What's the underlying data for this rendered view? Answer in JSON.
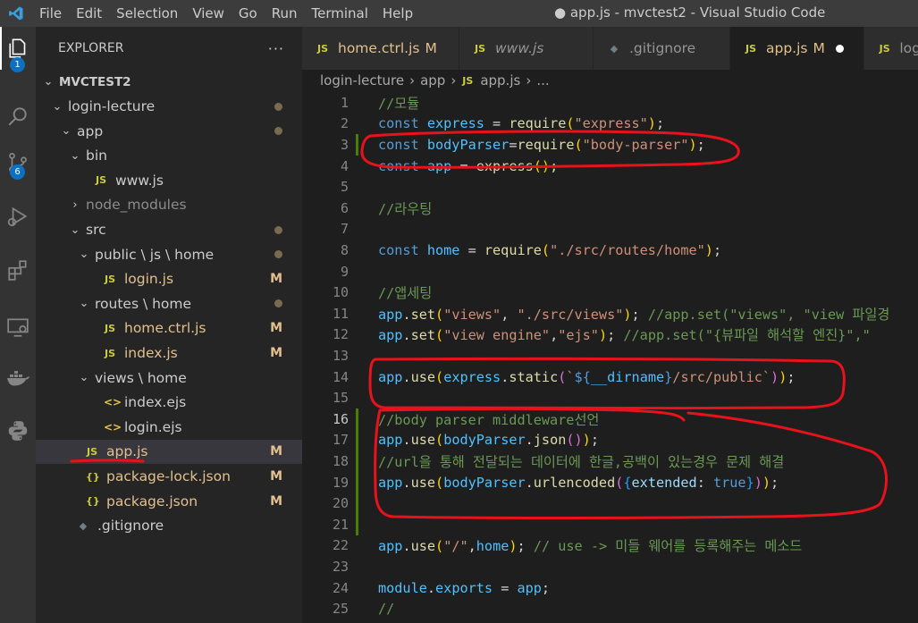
{
  "titlebar": {
    "menu": [
      "File",
      "Edit",
      "Selection",
      "View",
      "Go",
      "Run",
      "Terminal",
      "Help"
    ],
    "title": "● app.js - mvctest2 - Visual Studio Code"
  },
  "activity": {
    "icons": [
      "explorer-icon",
      "search-icon",
      "source-control-icon",
      "run-debug-icon",
      "extensions-icon",
      "remote-explorer-icon",
      "docker-icon",
      "python-icon"
    ],
    "badges": {
      "explorer": "1",
      "source_control": "6"
    }
  },
  "explorer": {
    "title": "EXPLORER",
    "more": "···",
    "project": "MVCTEST2",
    "tree": [
      {
        "label": "login-lecture",
        "status": "dot",
        "indent": 1,
        "kind": "folder-open"
      },
      {
        "label": "app",
        "status": "dot",
        "indent": 2,
        "kind": "folder-open"
      },
      {
        "label": "bin",
        "status": "",
        "indent": 3,
        "kind": "folder-open"
      },
      {
        "label": "www.js",
        "status": "",
        "indent": 4,
        "kind": "js"
      },
      {
        "label": "node_modules",
        "status": "",
        "indent": 3,
        "kind": "folder-closed",
        "muted": true
      },
      {
        "label": "src",
        "status": "dot",
        "indent": 3,
        "kind": "folder-open"
      },
      {
        "label": "public \\ js \\ home",
        "status": "dot",
        "indent": 4,
        "kind": "folder-open"
      },
      {
        "label": "login.js",
        "status": "M",
        "indent": 5,
        "kind": "js"
      },
      {
        "label": "routes \\ home",
        "status": "dot",
        "indent": 4,
        "kind": "folder-open"
      },
      {
        "label": "home.ctrl.js",
        "status": "M",
        "indent": 5,
        "kind": "js"
      },
      {
        "label": "index.js",
        "status": "M",
        "indent": 5,
        "kind": "js"
      },
      {
        "label": "views \\ home",
        "status": "",
        "indent": 4,
        "kind": "folder-open"
      },
      {
        "label": "index.ejs",
        "status": "",
        "indent": 5,
        "kind": "ejs"
      },
      {
        "label": "login.ejs",
        "status": "",
        "indent": 5,
        "kind": "ejs"
      },
      {
        "label": "app.js",
        "status": "M",
        "indent": 3,
        "kind": "js",
        "selected": true
      },
      {
        "label": "package-lock.json",
        "status": "M",
        "indent": 3,
        "kind": "json"
      },
      {
        "label": "package.json",
        "status": "M",
        "indent": 3,
        "kind": "json"
      },
      {
        "label": ".gitignore",
        "status": "",
        "indent": 2,
        "kind": "git"
      }
    ]
  },
  "tabs": [
    {
      "label": "home.ctrl.js",
      "icon": "JS",
      "mark": "M",
      "active": false,
      "italic": false
    },
    {
      "label": "www.js",
      "icon": "JS",
      "mark": "",
      "active": false,
      "italic": true
    },
    {
      "label": ".gitignore",
      "icon": "◆",
      "mark": "",
      "active": false,
      "italic": false
    },
    {
      "label": "app.js",
      "icon": "JS",
      "mark": "M",
      "active": true,
      "italic": false,
      "dirty": true
    },
    {
      "label": "log",
      "icon": "JS",
      "mark": "",
      "active": false,
      "italic": false
    }
  ],
  "breadcrumb": [
    "login-lecture",
    "app",
    "app.js",
    "..."
  ],
  "editor": {
    "current_line": 16,
    "lines": [
      {
        "n": 1,
        "tokens": [
          [
            "com",
            "//모듈"
          ]
        ]
      },
      {
        "n": 2,
        "tokens": [
          [
            "kw",
            "const"
          ],
          [
            "pl",
            " "
          ],
          [
            "var",
            "express"
          ],
          [
            "pl",
            " = "
          ],
          [
            "fn",
            "require"
          ],
          [
            "p1",
            "("
          ],
          [
            "str",
            "\"express\""
          ],
          [
            "p1",
            ")"
          ],
          [
            "pl",
            ";"
          ]
        ]
      },
      {
        "n": 3,
        "tokens": [
          [
            "kw",
            "const"
          ],
          [
            "pl",
            " "
          ],
          [
            "var",
            "bodyParser"
          ],
          [
            "pl",
            "="
          ],
          [
            "fn",
            "require"
          ],
          [
            "p1",
            "("
          ],
          [
            "str",
            "\"body-parser\""
          ],
          [
            "p1",
            ")"
          ],
          [
            "pl",
            ";"
          ]
        ],
        "mark": true
      },
      {
        "n": 4,
        "tokens": [
          [
            "kw",
            "const"
          ],
          [
            "pl",
            " "
          ],
          [
            "var",
            "app"
          ],
          [
            "pl",
            " = "
          ],
          [
            "fn",
            "express"
          ],
          [
            "p1",
            "()"
          ],
          [
            "pl",
            ";"
          ]
        ]
      },
      {
        "n": 5,
        "tokens": []
      },
      {
        "n": 6,
        "tokens": [
          [
            "com",
            "//라우팅"
          ]
        ]
      },
      {
        "n": 7,
        "tokens": []
      },
      {
        "n": 8,
        "tokens": [
          [
            "kw",
            "const"
          ],
          [
            "pl",
            " "
          ],
          [
            "var",
            "home"
          ],
          [
            "pl",
            " = "
          ],
          [
            "fn",
            "require"
          ],
          [
            "p1",
            "("
          ],
          [
            "str",
            "\"./src/routes/home\""
          ],
          [
            "p1",
            ")"
          ],
          [
            "pl",
            ";"
          ]
        ]
      },
      {
        "n": 9,
        "tokens": []
      },
      {
        "n": 10,
        "tokens": [
          [
            "com",
            "//앱세팅"
          ]
        ]
      },
      {
        "n": 11,
        "tokens": [
          [
            "var",
            "app"
          ],
          [
            "pl",
            "."
          ],
          [
            "fn",
            "set"
          ],
          [
            "p1",
            "("
          ],
          [
            "str",
            "\"views\""
          ],
          [
            "pl",
            ", "
          ],
          [
            "str",
            "\"./src/views\""
          ],
          [
            "p1",
            ")"
          ],
          [
            "pl",
            "; "
          ],
          [
            "com",
            "//app.set(\"views\", \"view 파일경"
          ]
        ]
      },
      {
        "n": 12,
        "tokens": [
          [
            "var",
            "app"
          ],
          [
            "pl",
            "."
          ],
          [
            "fn",
            "set"
          ],
          [
            "p1",
            "("
          ],
          [
            "str",
            "\"view engine\""
          ],
          [
            "pl",
            ","
          ],
          [
            "str",
            "\"ejs\""
          ],
          [
            "p1",
            ")"
          ],
          [
            "pl",
            "; "
          ],
          [
            "com",
            "//app.set(\"{뷰파일 해석할 엔진}\",\""
          ]
        ]
      },
      {
        "n": 13,
        "tokens": []
      },
      {
        "n": 14,
        "tokens": [
          [
            "var",
            "app"
          ],
          [
            "pl",
            "."
          ],
          [
            "fn",
            "use"
          ],
          [
            "p1",
            "("
          ],
          [
            "var",
            "express"
          ],
          [
            "pl",
            "."
          ],
          [
            "fn",
            "static"
          ],
          [
            "p2",
            "("
          ],
          [
            "str",
            "`"
          ],
          [
            "kw",
            "${"
          ],
          [
            "var",
            "__dirname"
          ],
          [
            "kw",
            "}"
          ],
          [
            "str",
            "/src/public`"
          ],
          [
            "p2",
            ")"
          ],
          [
            "p1",
            ")"
          ],
          [
            "pl",
            ";"
          ]
        ]
      },
      {
        "n": 15,
        "tokens": []
      },
      {
        "n": 16,
        "tokens": [
          [
            "com",
            "//body parser middleware선언"
          ]
        ],
        "mark": true
      },
      {
        "n": 17,
        "tokens": [
          [
            "var",
            "app"
          ],
          [
            "pl",
            "."
          ],
          [
            "fn",
            "use"
          ],
          [
            "p1",
            "("
          ],
          [
            "var",
            "bodyParser"
          ],
          [
            "pl",
            "."
          ],
          [
            "fn",
            "json"
          ],
          [
            "p2",
            "()"
          ],
          [
            "p1",
            ")"
          ],
          [
            "pl",
            ";"
          ]
        ],
        "mark": true
      },
      {
        "n": 18,
        "tokens": [
          [
            "com",
            "//url을 통해 전달되는 데이터에 한글,공백이 있는경우 문제 해결"
          ]
        ],
        "mark": true
      },
      {
        "n": 19,
        "tokens": [
          [
            "var",
            "app"
          ],
          [
            "pl",
            "."
          ],
          [
            "fn",
            "use"
          ],
          [
            "p1",
            "("
          ],
          [
            "var",
            "bodyParser"
          ],
          [
            "pl",
            "."
          ],
          [
            "fn",
            "urlencoded"
          ],
          [
            "p2",
            "("
          ],
          [
            "p3",
            "{"
          ],
          [
            "prop",
            "extended"
          ],
          [
            "pl",
            ": "
          ],
          [
            "kw",
            "true"
          ],
          [
            "p3",
            "}"
          ],
          [
            "p2",
            ")"
          ],
          [
            "p1",
            ")"
          ],
          [
            "pl",
            ";"
          ]
        ],
        "mark": true
      },
      {
        "n": 20,
        "tokens": [],
        "mark": true
      },
      {
        "n": 21,
        "tokens": [],
        "mark": true
      },
      {
        "n": 22,
        "tokens": [
          [
            "var",
            "app"
          ],
          [
            "pl",
            "."
          ],
          [
            "fn",
            "use"
          ],
          [
            "p1",
            "("
          ],
          [
            "str",
            "\"/\""
          ],
          [
            "pl",
            ","
          ],
          [
            "var",
            "home"
          ],
          [
            "p1",
            ")"
          ],
          [
            "pl",
            "; "
          ],
          [
            "com",
            "// use -> 미들 웨어를 등록해주는 메소드"
          ]
        ]
      },
      {
        "n": 23,
        "tokens": []
      },
      {
        "n": 24,
        "tokens": [
          [
            "var",
            "module"
          ],
          [
            "pl",
            "."
          ],
          [
            "var",
            "exports"
          ],
          [
            "pl",
            " = "
          ],
          [
            "var",
            "app"
          ],
          [
            "pl",
            ";"
          ]
        ]
      },
      {
        "n": 25,
        "tokens": [
          [
            "com",
            "//"
          ]
        ]
      }
    ]
  },
  "colors": {
    "annotation": "#e8121c",
    "modified": "#e2c08d",
    "gutter_added": "#487e02"
  }
}
